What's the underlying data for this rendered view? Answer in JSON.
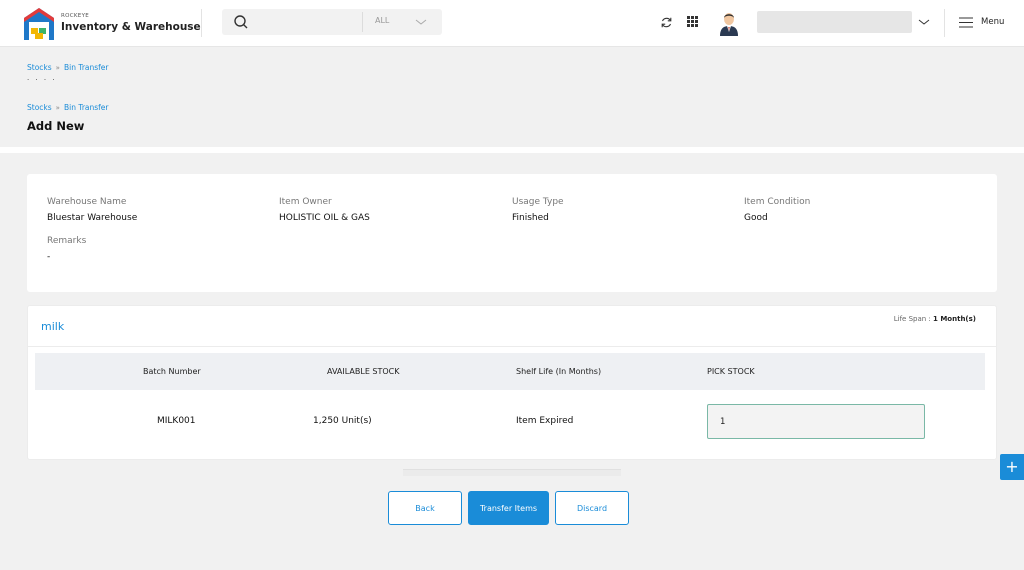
{
  "app": {
    "brand_small": "ROCKEYE",
    "brand_name": "Inventory & Warehouse"
  },
  "topbar": {
    "search_placeholder": "",
    "search_scope": "ALL",
    "menu_label": "Menu"
  },
  "breadcrumbs": [
    {
      "parent": "Stocks",
      "separator": "»",
      "current": "Bin Transfer"
    },
    {
      "parent": "Stocks",
      "separator": "»",
      "current": "Bin Transfer"
    }
  ],
  "ghost_title": "· · · ·",
  "page_title": "Add New",
  "info": {
    "warehouse_label": "Warehouse Name",
    "warehouse_value": "Bluestar Warehouse",
    "owner_label": "Item Owner",
    "owner_value": "HOLISTIC OIL & GAS",
    "usage_label": "Usage Type",
    "usage_value": "Finished",
    "condition_label": "Item Condition",
    "condition_value": "Good",
    "remarks_label": "Remarks",
    "remarks_value": "-"
  },
  "item": {
    "name": "milk",
    "lifespan_label": "Life Span :",
    "lifespan_value": "1 Month(s)",
    "columns": [
      "Batch Number",
      "AVAILABLE STOCK",
      "Shelf Life (In Months)",
      "PICK STOCK"
    ],
    "row": {
      "batch": "MILK001",
      "available": "1,250 Unit(s)",
      "shelf_life": "Item Expired",
      "pick": "1"
    }
  },
  "actions": {
    "back": "Back",
    "transfer": "Transfer Items",
    "discard": "Discard"
  },
  "fab_label": "+",
  "colors": {
    "accent": "#1a8cd8",
    "input_border": "#7ab8a6"
  }
}
